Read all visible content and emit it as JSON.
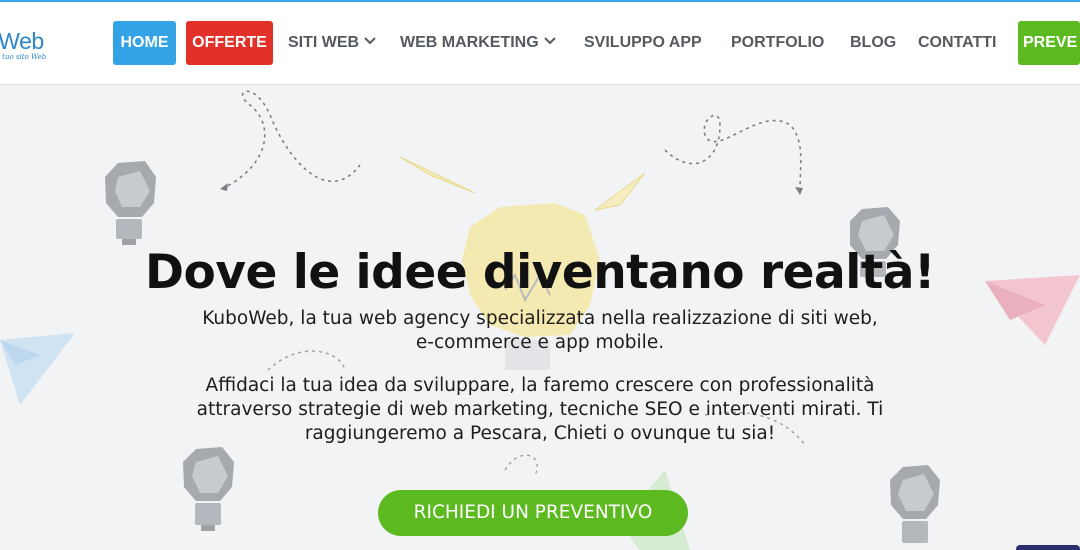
{
  "logo": {
    "text": "oWeb",
    "tagline": "ubo il tuo sito Web"
  },
  "nav": {
    "home": "HOME",
    "offerte": "OFFERTE",
    "siti_web": "SITI WEB",
    "web_marketing": "WEB MARKETING",
    "sviluppo_app": "SVILUPPO APP",
    "portfolio": "PORTFOLIO",
    "blog": "BLOG",
    "contatti": "CONTATTI",
    "preventivo": "PREVE"
  },
  "hero": {
    "title": "Dove le idee diventano realtà!",
    "intro_line1": "KuboWeb, la tua web agency specializzata nella realizzazione di siti web,",
    "intro_line2": "e-commerce e app mobile.",
    "body_line1": "Affidaci la tua idea da sviluppare, la faremo crescere con professionalità",
    "body_line2": "attraverso strategie di web marketing, tecniche SEO e interventi mirati. Ti",
    "body_line3": "raggiungeremo a Pescara, Chieti o ovunque tu sia!",
    "cta": "RICHIEDI UN PREVENTIVO"
  },
  "icons": [
    "chevron-down-icon",
    "lightbulb-icon",
    "paper-plane-icon",
    "dotted-arrow-icon"
  ],
  "colors": {
    "home": "#33a3e6",
    "offerte": "#e13128",
    "preventivo": "#5cba20",
    "cta": "#5cba20",
    "nav_text": "#555a60"
  }
}
